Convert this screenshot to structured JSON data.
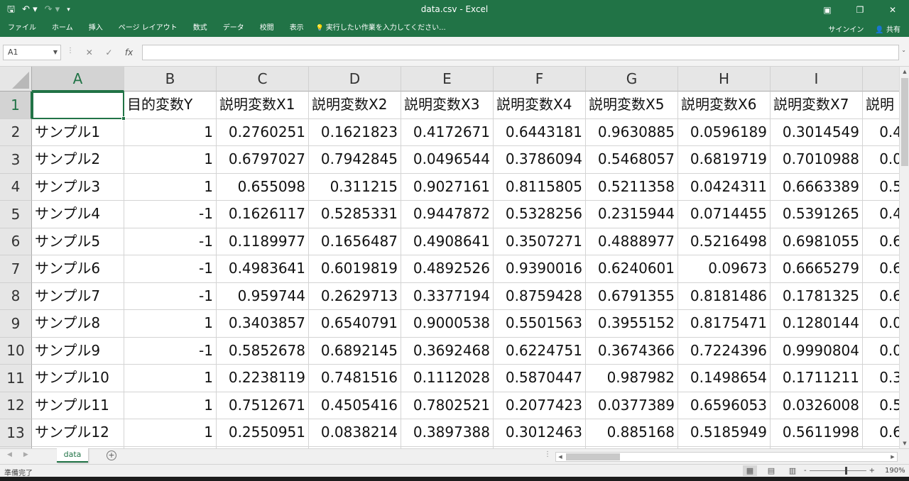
{
  "window": {
    "title": "data.csv - Excel",
    "accent": "#217346",
    "ribbon_display_icon": "ribbon-display-options-icon",
    "restore_icon": "restore-icon",
    "close_icon": "close-icon"
  },
  "quick_access": {
    "save_icon": "save-icon",
    "undo_icon": "undo-icon",
    "redo_icon": "redo-icon",
    "customize_icon": "customize-qat-icon"
  },
  "ribbon": {
    "tabs": [
      "ファイル",
      "ホーム",
      "挿入",
      "ページ レイアウト",
      "数式",
      "データ",
      "校閲",
      "表示"
    ],
    "tell_me": "実行したい作業を入力してください...",
    "sign_in": "サインイン",
    "share": "共有"
  },
  "formula_bar": {
    "name_box": "A1",
    "fx_label": "fx",
    "formula": ""
  },
  "grid": {
    "columns": [
      "A",
      "B",
      "C",
      "D",
      "E",
      "F",
      "G",
      "H",
      "I",
      ""
    ],
    "rows": [
      [
        "",
        "目的変数Y",
        "説明変数X1",
        "説明変数X2",
        "説明変数X3",
        "説明変数X4",
        "説明変数X5",
        "説明変数X6",
        "説明変数X7",
        "説明"
      ],
      [
        "サンプル1",
        "1",
        "0.2760251",
        "0.1621823",
        "0.4172671",
        "0.6443181",
        "0.9630885",
        "0.0596189",
        "0.3014549",
        "0.4"
      ],
      [
        "サンプル2",
        "1",
        "0.6797027",
        "0.7942845",
        "0.0496544",
        "0.3786094",
        "0.5468057",
        "0.6819719",
        "0.7010988",
        "0.0"
      ],
      [
        "サンプル3",
        "1",
        "0.655098",
        "0.311215",
        "0.9027161",
        "0.8115805",
        "0.5211358",
        "0.0424311",
        "0.6663389",
        "0.5"
      ],
      [
        "サンプル4",
        "-1",
        "0.1626117",
        "0.5285331",
        "0.9447872",
        "0.5328256",
        "0.2315944",
        "0.0714455",
        "0.5391265",
        "0.4"
      ],
      [
        "サンプル5",
        "-1",
        "0.1189977",
        "0.1656487",
        "0.4908641",
        "0.3507271",
        "0.4888977",
        "0.5216498",
        "0.6981055",
        "0.6"
      ],
      [
        "サンプル6",
        "-1",
        "0.4983641",
        "0.6019819",
        "0.4892526",
        "0.9390016",
        "0.6240601",
        "0.09673",
        "0.6665279",
        "0.6"
      ],
      [
        "サンプル7",
        "-1",
        "0.959744",
        "0.2629713",
        "0.3377194",
        "0.8759428",
        "0.6791355",
        "0.8181486",
        "0.1781325",
        "0.6"
      ],
      [
        "サンプル8",
        "1",
        "0.3403857",
        "0.6540791",
        "0.9000538",
        "0.5501563",
        "0.3955152",
        "0.8175471",
        "0.1280144",
        "0.0"
      ],
      [
        "サンプル9",
        "-1",
        "0.5852678",
        "0.6892145",
        "0.3692468",
        "0.6224751",
        "0.3674366",
        "0.7224396",
        "0.9990804",
        "0.0"
      ],
      [
        "サンプル10",
        "1",
        "0.2238119",
        "0.7481516",
        "0.1112028",
        "0.5870447",
        "0.987982",
        "0.1498654",
        "0.1711211",
        "0.3"
      ],
      [
        "サンプル11",
        "1",
        "0.7512671",
        "0.4505416",
        "0.7802521",
        "0.2077423",
        "0.0377389",
        "0.6596053",
        "0.0326008",
        "0.5"
      ],
      [
        "サンプル12",
        "1",
        "0.2550951",
        "0.0838214",
        "0.3897388",
        "0.3012463",
        "0.885168",
        "0.5185949",
        "0.5611998",
        "0.6"
      ],
      [
        "",
        "",
        "",
        "",
        "",
        "",
        "",
        "",
        "",
        ""
      ]
    ]
  },
  "sheets": {
    "active": "data",
    "add_icon": "add-sheet-icon"
  },
  "status": {
    "ready": "準備完了",
    "zoom": "190%",
    "zoom_minus": "-",
    "zoom_plus": "+"
  }
}
